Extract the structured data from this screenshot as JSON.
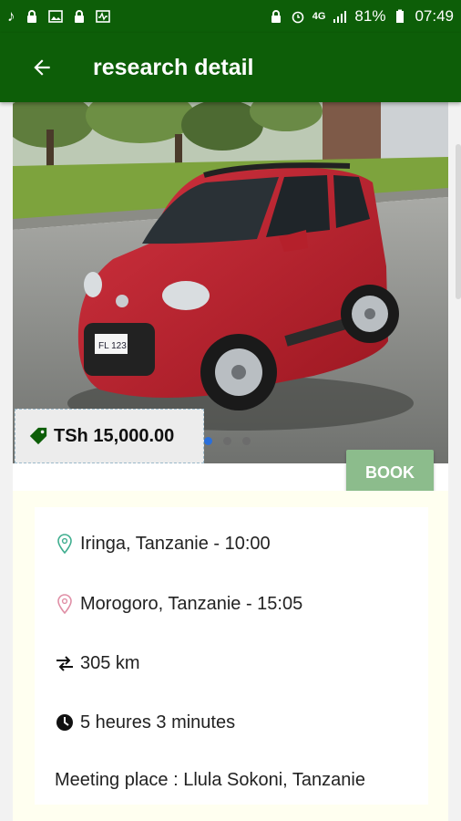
{
  "status": {
    "battery": "81%",
    "time": "07:49",
    "network": "4G"
  },
  "appbar": {
    "title": "research detail"
  },
  "listing": {
    "price": "TSh 15,000.00",
    "book_label": "BOOK",
    "departure": "Iringa, Tanzanie - 10:00",
    "arrival": "Morogoro, Tanzanie - 15:05",
    "distance": "305 km",
    "duration": "5 heures 3 minutes",
    "meeting_place": "Meeting place : Llula Sokoni, Tanzanie"
  },
  "icons": {
    "back": "arrow-left-icon",
    "price": "tag-icon",
    "departure": "location-pin-green-icon",
    "arrival": "location-pin-pink-icon",
    "distance": "swap-arrows-icon",
    "duration": "clock-icon"
  },
  "colors": {
    "primary": "#0d5e08",
    "book_button": "#8cbc8c",
    "departure_pin": "#3fae8f",
    "arrival_pin": "#e08fa6",
    "details_bg": "#fffff0"
  }
}
